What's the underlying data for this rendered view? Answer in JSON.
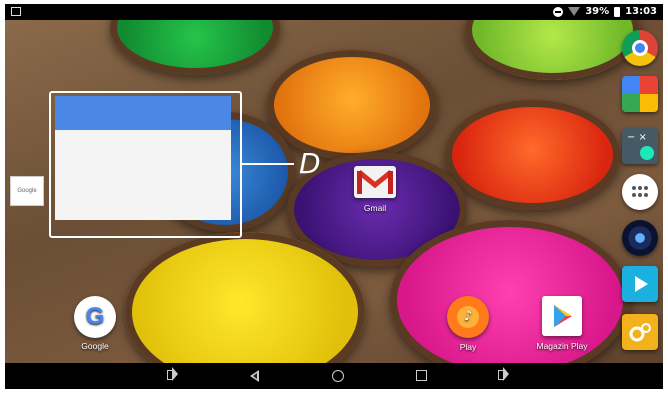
{
  "statusbar": {
    "battery": "39%",
    "time": "13:03"
  },
  "callout": {
    "letter": "D"
  },
  "widget": {
    "name": "Google"
  },
  "apps": {
    "gmail": "Gmail",
    "google": "Google",
    "play": "Play",
    "magazin": "Magazin Play"
  },
  "dock": [
    "chrome-icon",
    "photos-icon",
    "calculator-icon",
    "apps-drawer-icon",
    "music-icon",
    "video-icon",
    "settings-icon"
  ],
  "colors": {
    "widget_header": "#4b88e6",
    "status_bg": "#000000"
  }
}
